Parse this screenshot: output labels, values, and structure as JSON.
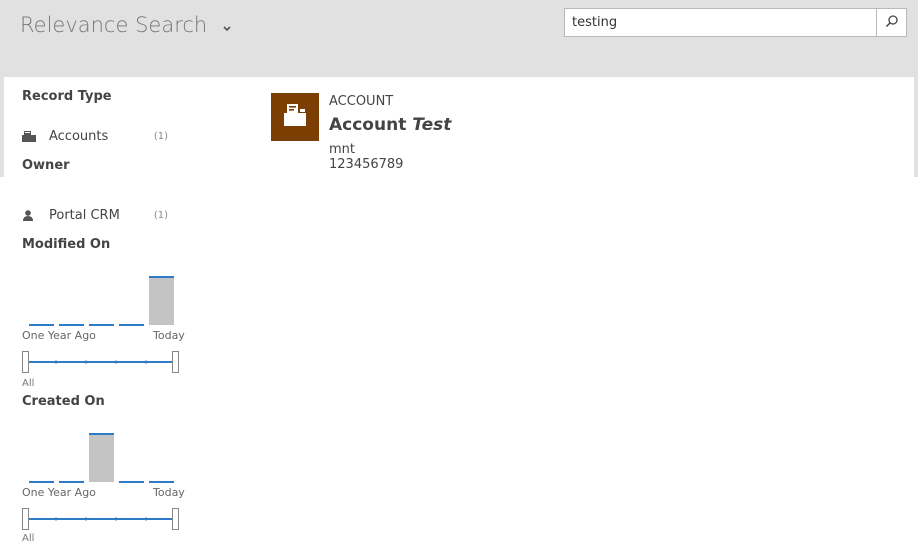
{
  "header": {
    "title": "Relevance Search",
    "search": {
      "value": "testing",
      "placeholder": ""
    }
  },
  "facets": {
    "record_type": {
      "heading": "Record Type",
      "items": [
        {
          "label": "Accounts",
          "count": "(1)",
          "icon": "account-icon"
        }
      ]
    },
    "owner": {
      "heading": "Owner",
      "items": [
        {
          "label": "Portal CRM",
          "count": "(1)",
          "icon": "user-icon"
        }
      ]
    },
    "modified_on": {
      "heading": "Modified On",
      "left_label": "One Year Ago",
      "right_label": "Today",
      "range_label": "All",
      "buckets": [
        0,
        0,
        0,
        0,
        1
      ]
    },
    "created_on": {
      "heading": "Created On",
      "left_label": "One Year Ago",
      "right_label": "Today",
      "range_label": "All",
      "buckets": [
        0,
        0,
        1,
        0,
        0
      ]
    }
  },
  "results": [
    {
      "type": "ACCOUNT",
      "name_prefix": "Account",
      "name_highlight": "Test",
      "field1": "mnt",
      "field2": "123456789",
      "tile_color": "#7b3e03"
    }
  ],
  "colors": {
    "accent": "#2e7bc8",
    "bar": "#c4c4c4",
    "header_bg": "#e1e1e1"
  }
}
